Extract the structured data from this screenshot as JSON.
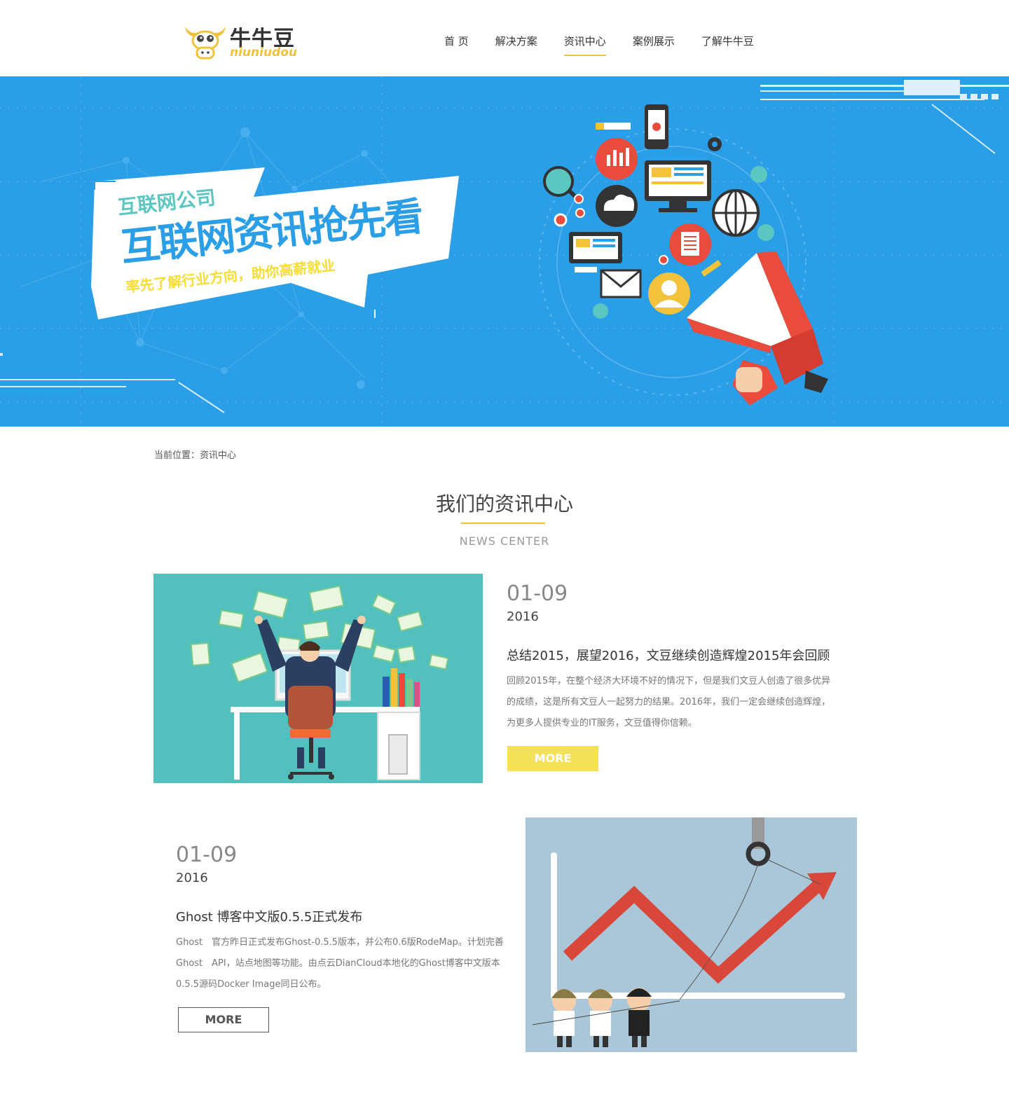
{
  "header": {
    "logo_cn": "牛牛豆",
    "logo_en": "niuniudou",
    "nav": [
      {
        "label": "首 页"
      },
      {
        "label": "解决方案"
      },
      {
        "label": "资讯中心"
      },
      {
        "label": "案例展示"
      },
      {
        "label": "了解牛牛豆"
      }
    ]
  },
  "banner": {
    "tag_small": "互联网公司",
    "tag_big": "互联网资讯抢先看",
    "tag_sub": "率先了解行业方向，助你高薪就业"
  },
  "breadcrumb": "当前位置：资讯中心",
  "section": {
    "title": "我们的资讯中心",
    "subtitle": "NEWS CENTER"
  },
  "news": [
    {
      "date": "01-09",
      "year": "2016",
      "title": "总结2015，展望2016，文豆继续创造辉煌2015年会回顾",
      "desc": "回顾2015年，在整个经济大环境不好的情况下，但是我们文豆人创造了很多优异的成绩，这是所有文豆人一起努力的结果。2016年，我们一定会继续创造辉煌，为更多人提供专业的IT服务，文豆值得你信赖。",
      "more": "MORE"
    },
    {
      "date": "01-09",
      "year": "2016",
      "title": "Ghost 博客中文版0.5.5正式发布",
      "desc": "Ghost　官方昨日正式发布Ghost-0.5.5版本，并公布0.6版RodeMap。计划完善Ghost　API，站点地图等功能。由点云DianCloud本地化的Ghost博客中文版本0.5.5源码Docker Image同日公布。",
      "more": "MORE"
    }
  ],
  "colors": {
    "accent": "#f2c23a",
    "banner_bg": "#2a9ee6",
    "more_yellow": "#f5e05a"
  }
}
